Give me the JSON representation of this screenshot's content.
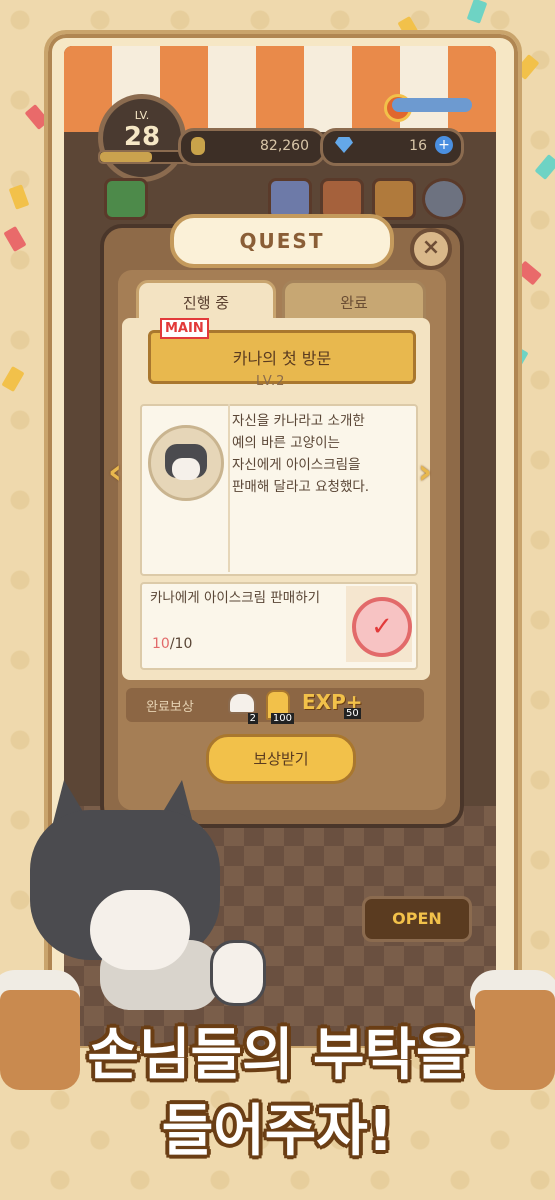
{
  "hud": {
    "level_label": "LV.",
    "level": "28",
    "coins": "82,260",
    "gems": "16"
  },
  "quest": {
    "title": "QUEST",
    "close": "×",
    "tabs": [
      "진행 중",
      "완료"
    ],
    "main_tag": "MAIN",
    "name": "카나의 첫 방문",
    "level": "LV.2",
    "description": "자신을 카나라고 소개한\n예의 바른 고양이는\n자신에게 아이스크림을\n판매해 달라고 요청했다.",
    "task": "카나에게 아이스크림 판매하기",
    "progress_done": "10",
    "progress_total": "/10",
    "reward_label": "완료보상",
    "rewards": [
      {
        "name": "ice-cream-reward",
        "count": "2"
      },
      {
        "name": "gold-reward",
        "count": "100"
      }
    ],
    "exp_label": "EXP+",
    "exp_value": "50",
    "claim_button": "보상받기"
  },
  "shop": {
    "open_sign": "OPEN"
  },
  "headline": {
    "line1": "손님들의 부탁을",
    "line2": "들어주자!"
  },
  "colors": {
    "accent": "#f2c14a",
    "background": "#efd9ad",
    "progress_done": "#e26a6a"
  }
}
